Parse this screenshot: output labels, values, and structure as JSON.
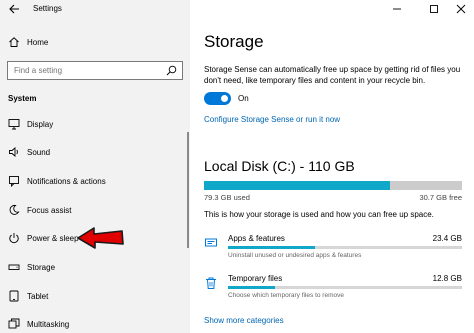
{
  "window": {
    "title": "Settings",
    "controls": [
      "minimize-icon",
      "maximize-icon",
      "close-icon"
    ]
  },
  "sidebar": {
    "home_label": "Home",
    "search_placeholder": "Find a setting",
    "section_label": "System",
    "items": [
      {
        "label": "Display",
        "icon": "display-icon"
      },
      {
        "label": "Sound",
        "icon": "speaker-icon"
      },
      {
        "label": "Notifications & actions",
        "icon": "notification-icon"
      },
      {
        "label": "Focus assist",
        "icon": "moon-icon"
      },
      {
        "label": "Power & sleep",
        "icon": "power-icon"
      },
      {
        "label": "Storage",
        "icon": "storage-icon"
      },
      {
        "label": "Tablet",
        "icon": "tablet-icon"
      },
      {
        "label": "Multitasking",
        "icon": "multitasking-icon"
      }
    ]
  },
  "main": {
    "title": "Storage",
    "description": "Storage Sense can automatically free up space by getting rid of files you don't need, like temporary files and content in your recycle bin.",
    "toggle": {
      "state_label": "On",
      "on": true
    },
    "configure_link": "Configure Storage Sense or run it now",
    "disk": {
      "title": "Local Disk (C:) - 110 GB",
      "used_label": "79.3 GB used",
      "free_label": "30.7 GB free",
      "used_fraction": 0.721,
      "info_text": "This is how your storage is used and how you can free up space."
    },
    "categories": [
      {
        "name": "Apps & features",
        "size": "23.4 GB",
        "subtitle": "Uninstall unused or undesired apps & features",
        "fraction": 0.37,
        "icon": "apps-icon"
      },
      {
        "name": "Temporary files",
        "size": "12.8 GB",
        "subtitle": "Choose which temporary files to remove",
        "fraction": 0.2,
        "icon": "trash-icon"
      }
    ],
    "show_more_link": "Show more categories"
  },
  "colors": {
    "accent": "#0078d7",
    "bar": "#10a8c8",
    "link": "#0066b4",
    "annotation_arrow": "#e00000"
  }
}
